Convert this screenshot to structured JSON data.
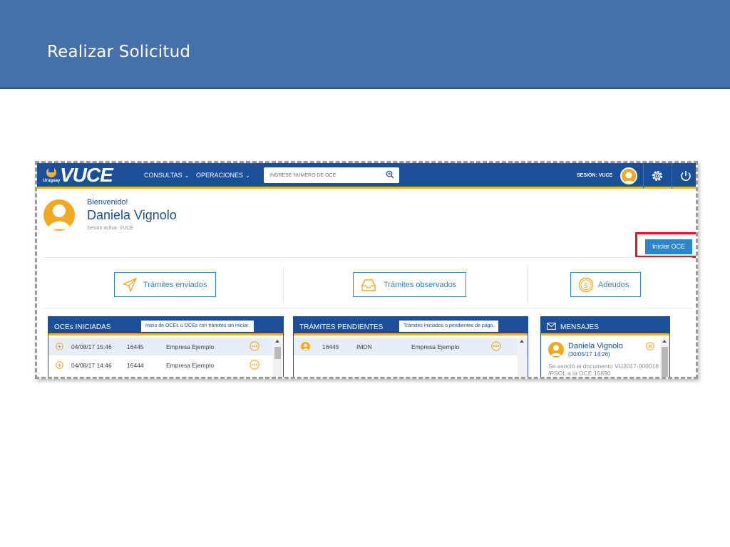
{
  "slide": {
    "title": "Realizar Solicitud"
  },
  "navbar": {
    "logo_country": "Uruguay",
    "logo_brand": "VUCE",
    "menu": [
      {
        "label": "CONSULTAS"
      },
      {
        "label": "OPERACIONES"
      }
    ],
    "search_placeholder": "INGRESE NÚMERO DE OCE",
    "session_label": "SESIÓN: VUCE",
    "icons": [
      "search-icon",
      "user-avatar",
      "gear-icon",
      "power-icon"
    ]
  },
  "welcome": {
    "greeting": "Bienvenido!",
    "user_name": "Daniela Vignolo",
    "session_active": "Sesión activa: VUCE"
  },
  "actions": {
    "start_oce": "Iniciar OCE",
    "highlight_color": "#e0151b"
  },
  "quick_links": [
    {
      "label": "Trámites enviados",
      "icon": "paper-plane-icon"
    },
    {
      "label": "Trámites observados",
      "icon": "inbox-icon"
    },
    {
      "label": "Adeudos",
      "icon": "dollar-coin-icon"
    }
  ],
  "panels": {
    "oces_iniciadas": {
      "title": "OCEs INICIADAS",
      "tip": "Inicio de OCEs u OCEs con trámites sin iniciar.",
      "rows": [
        {
          "date": "04/08/17 15:46",
          "number": "16445",
          "company": "Empresa Ejemplo"
        },
        {
          "date": "04/08/17 14:46",
          "number": "16444",
          "company": "Empresa Ejemplo"
        }
      ]
    },
    "tramites_pendientes": {
      "title": "TRÁMITES PENDIENTES",
      "tip": "Trámites iniciados o pendientes de pago.",
      "rows": [
        {
          "number": "16445",
          "type": "IMDN",
          "company": "Empresa Ejemplo"
        }
      ]
    },
    "mensajes": {
      "title": "MENSAJES",
      "items": [
        {
          "name": "Daniela Vignolo",
          "date": "(30/05/17 14:26)",
          "text": "Se asoció el documento VU2017-000018 /PSOL a la OCE 15890"
        }
      ]
    }
  },
  "colors": {
    "slide_header": "#4670aa",
    "nav_blue": "#1b4f9a",
    "accent_yellow": "#f2b233",
    "link_blue": "#2c86c9"
  }
}
